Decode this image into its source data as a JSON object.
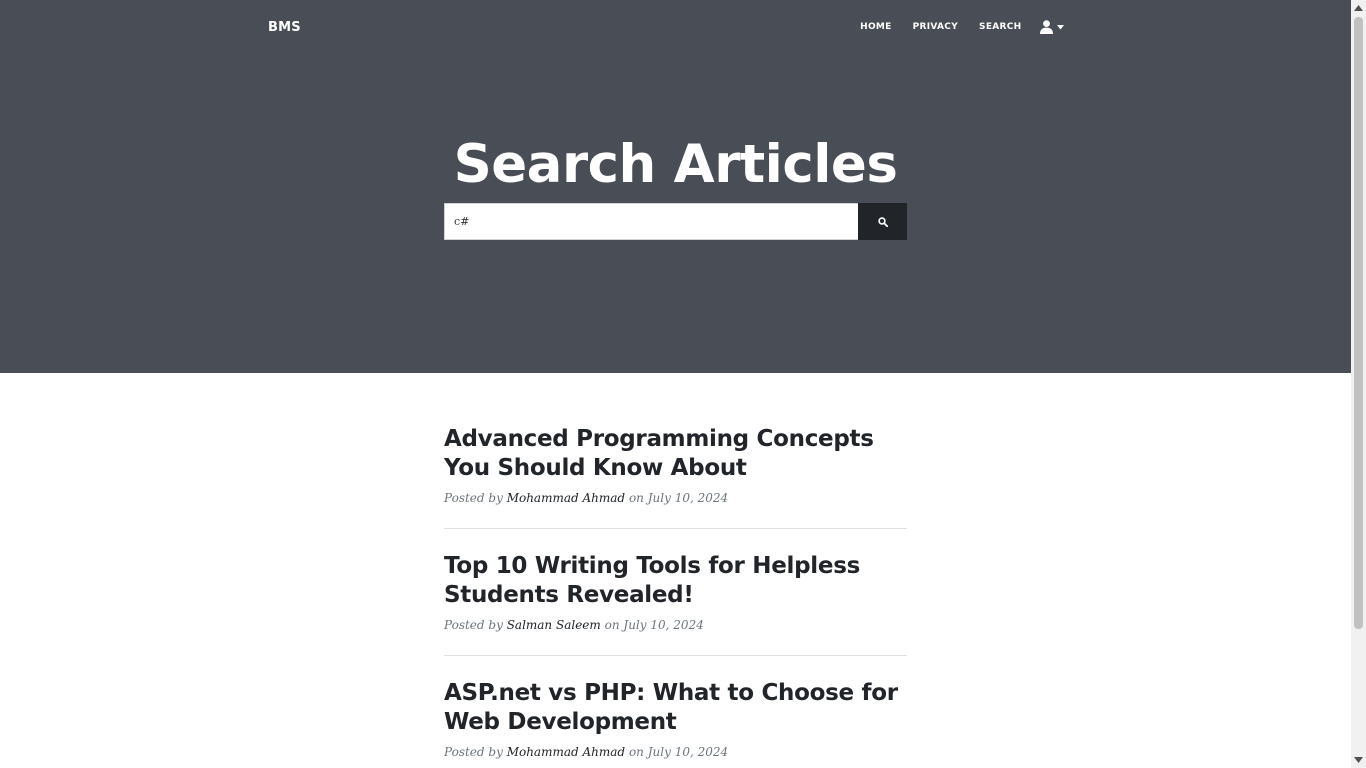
{
  "navbar": {
    "brand": "BMS",
    "links": [
      {
        "label": "HOME"
      },
      {
        "label": "PRIVACY"
      },
      {
        "label": "SEARCH"
      }
    ],
    "user_icon": "user-icon",
    "caret_icon": "chevron-down-icon"
  },
  "hero": {
    "title": "Search Articles"
  },
  "search": {
    "value": "c#",
    "button_icon": "search-icon"
  },
  "posts": [
    {
      "title": "Advanced Programming Concepts You Should Know About",
      "posted_by": "Posted by",
      "author": "Mohammad Ahmad",
      "on": "on",
      "date": "July 10, 2024"
    },
    {
      "title": "Top 10 Writing Tools for Helpless Students Revealed!",
      "posted_by": "Posted by",
      "author": "Salman Saleem",
      "on": "on",
      "date": "July 10, 2024"
    },
    {
      "title": "ASP.net vs PHP: What to Choose for Web Development",
      "posted_by": "Posted by",
      "author": "Mohammad Ahmad",
      "on": "on",
      "date": "July 10, 2024"
    }
  ],
  "colors": {
    "masthead": "#494d55",
    "search_button": "#212529",
    "title_text": "#212529",
    "meta_text": "#6c757d"
  }
}
